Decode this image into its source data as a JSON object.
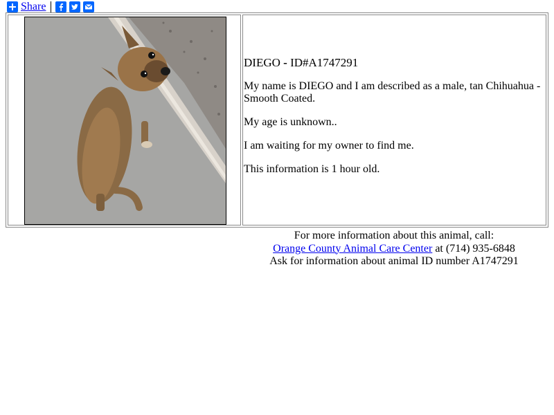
{
  "share": {
    "label": "Share",
    "icons": [
      "plus-icon",
      "facebook-icon",
      "twitter-icon",
      "email-icon"
    ],
    "brand_color": "#0166ff"
  },
  "animal": {
    "title_name": "DIEGO",
    "title_sep": "-",
    "title_id": "ID#A1747291",
    "description": "My name is DIEGO and I am described as a male, tan Chihuahua - Smooth Coated.",
    "age": "My age is unknown..",
    "status": "I am waiting for my owner to find me.",
    "freshness": "This information is 1 hour old."
  },
  "footer": {
    "line1": "For more information about this animal, call:",
    "center_link": "Orange County Animal Care Center",
    "phone": "at (714) 935-6848",
    "line3": "Ask for information about animal ID number A1747291"
  }
}
